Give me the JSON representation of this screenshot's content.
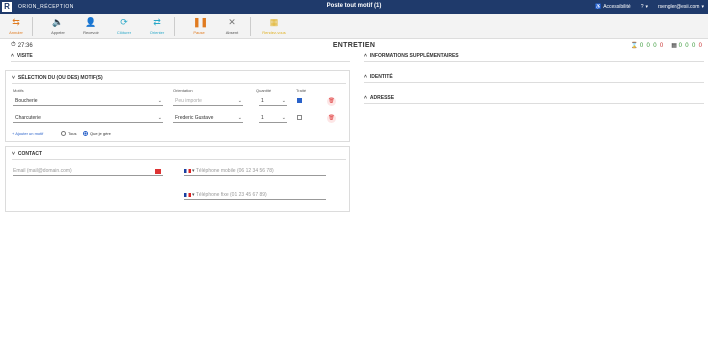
{
  "topbar": {
    "logo": "R",
    "app_name": "ORION_RÉCEPTION",
    "title": "Poste tout motif (1)",
    "accessibility": "Accessibilité",
    "help": "?",
    "user": "rsengler@esii.com"
  },
  "toolbar": {
    "buttons": [
      {
        "label": "Annuler",
        "icon": "undo-icon",
        "color": "#e07b20"
      },
      {
        "label": "Appeler",
        "icon": "speaker-icon",
        "color": "#777"
      },
      {
        "label": "Recevoir",
        "icon": "person-desk-icon",
        "color": "#777"
      },
      {
        "label": "Clôturer",
        "icon": "close-ticket-icon",
        "color": "#2aa8c8"
      },
      {
        "label": "Orienter",
        "icon": "transfer-icon",
        "color": "#2aa8c8"
      },
      {
        "label": "Pause",
        "icon": "pause-icon",
        "color": "#e07b20"
      },
      {
        "label": "Absent",
        "icon": "x-icon",
        "color": "#777"
      },
      {
        "label": "Rendez-vous",
        "icon": "calendar-icon",
        "color": "#e0b020"
      }
    ]
  },
  "timer": "27:36",
  "page_title": "ENTRETIEN",
  "counters": {
    "group1": [
      "0",
      "0",
      "0",
      "0"
    ],
    "group2": [
      "0",
      "0",
      "0",
      "0"
    ]
  },
  "visite": {
    "label": "VISITE",
    "motifs": {
      "heading": "SÉLECTION DU (OU DES) MOTIF(S)",
      "col_motif": "Motifs",
      "col_orientation": "Orientation",
      "col_quantite": "Quantité",
      "col_traite": "Traité",
      "rows": [
        {
          "motif": "Boucherie",
          "orientation": "",
          "orientation_placeholder": "Peu importe",
          "quantite": "1",
          "traite": true
        },
        {
          "motif": "Charcuterie",
          "orientation": "Frederic Gustave",
          "orientation_placeholder": "",
          "quantite": "1",
          "traite": false
        }
      ],
      "add_link": "+ Ajouter un motif",
      "radio_all": "Tous",
      "radio_mine": "Que je gère"
    }
  },
  "contact": {
    "heading": "CONTACT",
    "email_placeholder": "Email (mail@domain.com)",
    "mobile_placeholder": "Téléphone mobile (06 12 34 56 78)",
    "fixe_placeholder": "Téléphone fixe (01 23 45 67 89)"
  },
  "right": {
    "infos": "INFORMATIONS SUPPLÉMENTAIRES",
    "identite": "IDENTITÉ",
    "adresse": "ADRESSE"
  }
}
